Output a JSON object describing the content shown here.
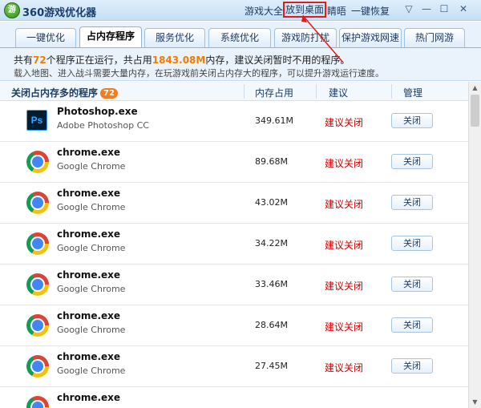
{
  "app": {
    "title": "360游戏优化器",
    "logo_text": "游",
    "top_links": [
      "游戏大全",
      "放到桌面",
      "睛晤",
      "一键恢复"
    ],
    "window_buttons": [
      "▽",
      "—",
      "☐",
      "✕"
    ]
  },
  "tabs": [
    "一键优化",
    "占内存程序",
    "服务优化",
    "系统优化",
    "游戏防打扰",
    "保护游戏网速",
    "热门网游"
  ],
  "active_tab_index": 1,
  "info": {
    "prefix": "共有",
    "program_count": "72",
    "middle": "个程序正在运行，共占用",
    "memory_total": "1843.08M",
    "suffix": "内存，建议关闭暂时不用的程序。",
    "tip": "载入地图、进入战斗需要大量内存，在玩游戏前关闭占内存大的程序，可以提升游戏运行速度。"
  },
  "columns": {
    "name": "关闭占内存多的程序",
    "count_badge": "72",
    "memory": "内存占用",
    "advice": "建议",
    "manage": "管理"
  },
  "rows": [
    {
      "icon": "photoshop-icon",
      "icon_text": "Ps",
      "name": "Photoshop.exe",
      "desc": "Adobe Photoshop CC",
      "memory": "349.61M",
      "advice": "建议关闭",
      "action": "关闭"
    },
    {
      "icon": "chrome-icon",
      "name": "chrome.exe",
      "desc": "Google Chrome",
      "memory": "89.68M",
      "advice": "建议关闭",
      "action": "关闭"
    },
    {
      "icon": "chrome-icon",
      "name": "chrome.exe",
      "desc": "Google Chrome",
      "memory": "43.02M",
      "advice": "建议关闭",
      "action": "关闭"
    },
    {
      "icon": "chrome-icon",
      "name": "chrome.exe",
      "desc": "Google Chrome",
      "memory": "34.22M",
      "advice": "建议关闭",
      "action": "关闭"
    },
    {
      "icon": "chrome-icon",
      "name": "chrome.exe",
      "desc": "Google Chrome",
      "memory": "33.46M",
      "advice": "建议关闭",
      "action": "关闭"
    },
    {
      "icon": "chrome-icon",
      "name": "chrome.exe",
      "desc": "Google Chrome",
      "memory": "28.64M",
      "advice": "建议关闭",
      "action": "关闭"
    },
    {
      "icon": "chrome-icon",
      "name": "chrome.exe",
      "desc": "Google Chrome",
      "memory": "27.45M",
      "advice": "建议关闭",
      "action": "关闭"
    },
    {
      "icon": "chrome-icon",
      "name": "chrome.exe",
      "desc": "",
      "memory": "",
      "advice": "",
      "action": ""
    }
  ],
  "colors": {
    "accent_orange": "#f07c00",
    "advice_red": "#d40000",
    "highlight_red": "#e31a1a",
    "title_blue": "#1a3d6b"
  }
}
